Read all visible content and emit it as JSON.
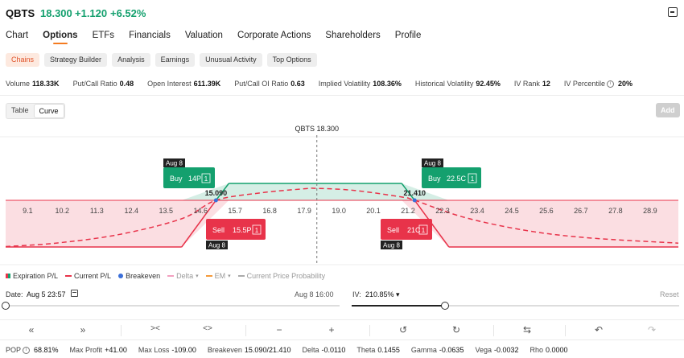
{
  "header": {
    "ticker": "QBTS",
    "price": "18.300",
    "change": "+1.120",
    "change_pct": "+6.52%"
  },
  "nav": {
    "tabs": [
      "Chart",
      "Options",
      "ETFs",
      "Financials",
      "Valuation",
      "Corporate Actions",
      "Shareholders",
      "Profile"
    ],
    "active": "Options"
  },
  "chips": {
    "items": [
      "Chains",
      "Strategy Builder",
      "Analysis",
      "Earnings",
      "Unusual Activity",
      "Top Options"
    ],
    "active": "Chains"
  },
  "stats": [
    {
      "label": "Volume",
      "value": "118.33K"
    },
    {
      "label": "Put/Call Ratio",
      "value": "0.48"
    },
    {
      "label": "Open Interest",
      "value": "611.39K"
    },
    {
      "label": "Put/Call OI Ratio",
      "value": "0.63"
    },
    {
      "label": "Implied Volatility",
      "value": "108.36%"
    },
    {
      "label": "Historical Volatility",
      "value": "92.45%"
    },
    {
      "label": "IV Rank",
      "value": "12"
    },
    {
      "label": "IV Percentile",
      "value": "20%"
    }
  ],
  "view_toggle": {
    "table": "Table",
    "curve": "Curve",
    "active": "Curve"
  },
  "add_label": "Add",
  "chart_data": {
    "type": "area",
    "title": "QBTS 18.300",
    "current_price": 18.3,
    "x_ticks": [
      "9.1",
      "10.2",
      "11.3",
      "12.4",
      "13.5",
      "14.6",
      "15.7",
      "16.8",
      "17.9",
      "19.0",
      "20.1",
      "21.2",
      "22.3",
      "23.4",
      "24.5",
      "25.6",
      "26.7",
      "27.8",
      "28.9"
    ],
    "xlim": [
      8.4,
      29.8
    ],
    "breakevens": [
      {
        "value": 15.09,
        "label": "15.090"
      },
      {
        "value": 21.41,
        "label": "21.410"
      }
    ],
    "series": [
      {
        "name": "Expiration P/L",
        "x": [
          8.4,
          14.0,
          15.5,
          21.0,
          22.5,
          29.8
        ],
        "y": [
          -109,
          -109,
          41,
          41,
          -109,
          -109
        ]
      },
      {
        "name": "Current P/L",
        "x": [
          8.4,
          10.0,
          12.0,
          14.0,
          15.09,
          16.5,
          17.9,
          18.3,
          19.5,
          21.0,
          21.41,
          23.0,
          25.0,
          27.0,
          29.8
        ],
        "y": [
          -108,
          -100,
          -80,
          -43,
          0,
          18,
          28,
          29,
          24,
          8,
          0,
          -40,
          -71,
          -88,
          -100
        ]
      }
    ],
    "legs": [
      {
        "action": "Buy",
        "strike_label": "14P",
        "qty": "1",
        "expiry": "Aug 8",
        "strike": 14.0
      },
      {
        "action": "Sell",
        "strike_label": "15.5P",
        "qty": "1",
        "expiry": "Aug 8",
        "strike": 15.5
      },
      {
        "action": "Sell",
        "strike_label": "21C",
        "qty": "1",
        "expiry": "Aug 8",
        "strike": 21.0
      },
      {
        "action": "Buy",
        "strike_label": "22.5C",
        "qty": "1",
        "expiry": "Aug 8",
        "strike": 22.5
      }
    ],
    "colors": {
      "profit": "#14a06e",
      "loss": "#e8334a",
      "breakeven": "#3b6fd9"
    }
  },
  "legend": {
    "items": [
      {
        "label": "Expiration P/L",
        "marker": "split-square"
      },
      {
        "label": "Current P/L",
        "marker": "dashed"
      },
      {
        "label": "Breakeven",
        "marker": "dot"
      },
      {
        "label": "Delta",
        "marker": "dash-pink",
        "dim": true,
        "dropdown": true
      },
      {
        "label": "EM",
        "marker": "dash-orange",
        "dim": true,
        "dropdown": true
      },
      {
        "label": "Current Price Probability",
        "marker": "dash-gray",
        "dim": true,
        "dropdown": false
      }
    ]
  },
  "date_control": {
    "label": "Date:",
    "value": "Aug 5 23:57",
    "end": "Aug 8 16:00",
    "progress": 0
  },
  "iv_control": {
    "label": "IV:",
    "value": "210.85%",
    "reset": "Reset",
    "progress": 0.285
  },
  "controls": {
    "icons": [
      "double-chevron-left-icon",
      "double-chevron-right-icon",
      "collapse-icon",
      "expand-icon",
      "minus-icon",
      "plus-icon",
      "undo-time-icon",
      "redo-time-icon",
      "swap-icon",
      "undo-icon",
      "redo-icon"
    ]
  },
  "footer": [
    {
      "label": "POP",
      "value": "68.81%",
      "info": true
    },
    {
      "label": "Max Profit",
      "value": "+41.00",
      "color": "green"
    },
    {
      "label": "Max Loss",
      "value": "-109.00",
      "color": "red"
    },
    {
      "label": "Breakeven",
      "value": "15.090/21.410"
    },
    {
      "label": "Delta",
      "value": "-0.0110"
    },
    {
      "label": "Theta",
      "value": "0.1455"
    },
    {
      "label": "Gamma",
      "value": "-0.0635"
    },
    {
      "label": "Vega",
      "value": "-0.0032"
    },
    {
      "label": "Rho",
      "value": "0.0000"
    }
  ]
}
